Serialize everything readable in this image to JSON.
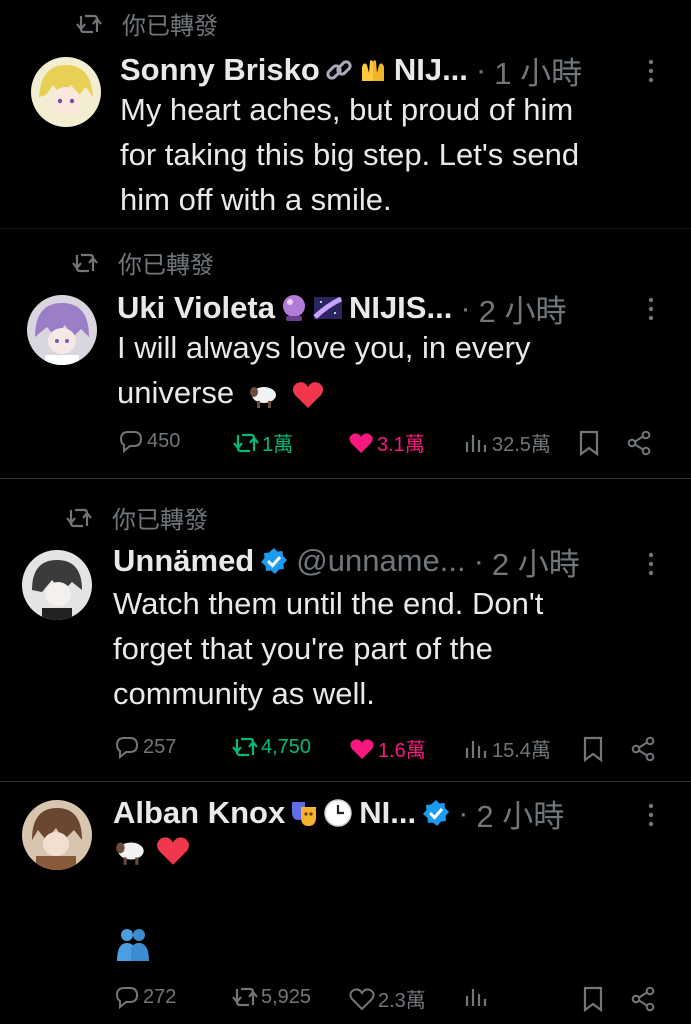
{
  "retweet_label": "你已轉發",
  "tweets": [
    {
      "name": "Sonny Brisko",
      "name_suffix": "NIJ...",
      "handle": "",
      "time": "1 小時",
      "text_lines": [
        "My heart aches, but proud of him",
        "for taking this big step. Let's send",
        "him off with a smile."
      ],
      "emojis": [
        "link-emoji",
        "raised-hands-emoji"
      ]
    },
    {
      "name": "Uki Violeta",
      "name_suffix": "NIJIS...",
      "handle": "",
      "time": "2 小時",
      "text_lines": [
        "I will always love you, in every",
        "universe"
      ],
      "emojis": [
        "crystal-ball-emoji",
        "milky-way-emoji"
      ],
      "stats": {
        "replies": "450",
        "retweets": "1萬",
        "likes": "3.1萬",
        "views": "32.5萬"
      }
    },
    {
      "name": "Unnämed",
      "handle": "@unname...",
      "time": "2 小時",
      "text_lines": [
        "Watch them until the end. Don't",
        "forget that you're part of the",
        "community as well."
      ],
      "stats": {
        "replies": "257",
        "retweets": "4,750",
        "likes": "1.6萬",
        "views": "15.4萬"
      }
    },
    {
      "name": "Alban Knox",
      "name_suffix": "NI...",
      "handle": "",
      "time": "2 小時",
      "emojis": [
        "performing-arts-emoji",
        "clock-emoji"
      ],
      "stats": {
        "replies": "272",
        "retweets": "5,925",
        "likes": "2.3萬",
        "views": ""
      }
    }
  ],
  "colors": {
    "background": "#000000",
    "text": "#e7e9ea",
    "muted": "#71767b",
    "retweet_active": "#00ba7c",
    "like_active": "#f91880",
    "verified": "#1d9bf0"
  }
}
